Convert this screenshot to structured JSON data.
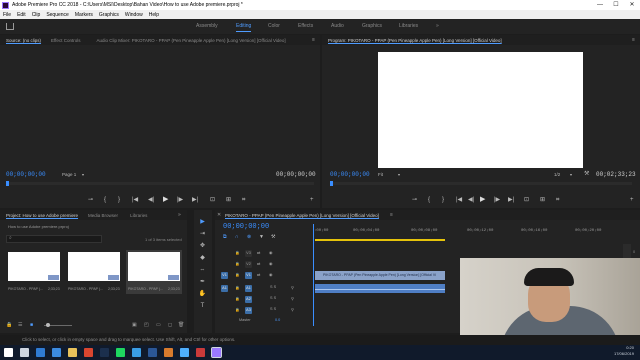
{
  "window": {
    "title": "Adobe Premiere Pro CC 2018 - C:\\Users\\MSI\\Desktop\\Bahan Video\\How to use Adobe premiere.prproj *",
    "minimize": "—",
    "maximize": "☐",
    "close": "✕"
  },
  "menu": [
    "File",
    "Edit",
    "Clip",
    "Sequence",
    "Markers",
    "Graphics",
    "Window",
    "Help"
  ],
  "workspaces": {
    "items": [
      "Assembly",
      "Editing",
      "Color",
      "Effects",
      "Audio",
      "Graphics",
      "Libraries"
    ],
    "active": "Editing",
    "more": "»"
  },
  "source": {
    "tabs": [
      "Source: (no clips)",
      "Effect Controls",
      "Audio Clip Mixer: PIKOTARO - PPAP (Pen Pineapple Apple Pen) [Long Version] [Official Video]"
    ],
    "tab_menu": "≡",
    "timecode_left": "00;00;00;00",
    "page_label": "Page 1",
    "timecode_right": "00;00;00;00"
  },
  "program": {
    "tab": "Program: PIKOTARO - PPAP (Pen Pineapple Apple Pen) [Long Version] [Official Video]",
    "tab_menu": "≡",
    "timecode_left": "00;00;00;00",
    "fit": "Fit",
    "resolution": "1/2",
    "timecode_right": "00;02;33;23"
  },
  "transport": [
    "⊸",
    "{",
    "}",
    "|◀",
    "◀|",
    "▶",
    "|▶",
    "▶|",
    "⊡",
    "⊞",
    "⌗",
    "+"
  ],
  "project": {
    "tabs": [
      "Project: How to use Adobe premiere",
      "Media Browser",
      "Libraries"
    ],
    "more": "»",
    "file_name": "How to use Adobe premiere.prproj",
    "selection": "1 of 3 items selected",
    "items": [
      {
        "label": "PIKOTARO - PPAP (...",
        "duration": "2;33;23"
      },
      {
        "label": "PIKOTARO - PPAP (...",
        "duration": "2;33;23"
      },
      {
        "label": "PIKOTARO - PPAP (...",
        "duration": "2;33;23"
      }
    ]
  },
  "tools": [
    "arrow-tool",
    "track-select-tool",
    "ripple-edit-tool",
    "razor-tool",
    "slip-tool",
    "pen-tool",
    "hand-tool",
    "type-tool"
  ],
  "tool_glyphs": [
    "▶",
    "⇥",
    "✥",
    "◆",
    "⇔",
    "✒",
    "✋",
    "T"
  ],
  "timeline": {
    "tab": "PIKOTARO - PPAP (Pen Pineapple Apple Pen) [Long Version] [Official Video]",
    "tab_menu": "≡",
    "timecode": "00;00;00;00",
    "ruler": [
      ":00;00",
      "00;00;04;00",
      "00;00;08;00",
      "00;00;12;00",
      "00;00;16;00",
      "00;00;20;00"
    ],
    "tracks": [
      {
        "label": "V3",
        "type": "video"
      },
      {
        "label": "V2",
        "type": "video"
      },
      {
        "label": "V1",
        "type": "video"
      },
      {
        "label": "A1",
        "type": "audio"
      },
      {
        "label": "A2",
        "type": "audio"
      },
      {
        "label": "A3",
        "type": "audio"
      }
    ],
    "target_v": "V1",
    "target_a": "A1",
    "clip_title": "PIKOTARO - PPAP (Pen Pineapple Apple Pen) [Long Version] [Official Vi",
    "master": "Master",
    "master_value": "0.0",
    "audio_meters": "S S"
  },
  "status": "Click to select, or click in empty space and drag to marquee select. Use Shift, Alt, and Ctrl for other options.",
  "taskbar": {
    "clock": "0:20",
    "date": "17/06/2019",
    "icons": [
      {
        "name": "windows-icon",
        "color": "#ffffff"
      },
      {
        "name": "task-view-icon",
        "color": "#cfd6df"
      },
      {
        "name": "edge-icon",
        "color": "#2f7bd3"
      },
      {
        "name": "store-icon",
        "color": "#3c8be0"
      },
      {
        "name": "explorer-icon",
        "color": "#e8c15a"
      },
      {
        "name": "chrome-icon",
        "color": "#d9462f"
      },
      {
        "name": "steam-icon",
        "color": "#1b2f4d"
      },
      {
        "name": "spotify-icon",
        "color": "#1ed760"
      },
      {
        "name": "app-icon",
        "color": "#3a9ee6"
      },
      {
        "name": "word-icon",
        "color": "#2b5797"
      },
      {
        "name": "lightroom-icon",
        "color": "#d87b2d"
      },
      {
        "name": "app2-icon",
        "color": "#4fb0ff"
      },
      {
        "name": "media-icon",
        "color": "#c93a3a"
      },
      {
        "name": "premiere-icon",
        "color": "#9a79ff"
      }
    ]
  },
  "colors": {
    "accent": "#4f9cff",
    "timecode": "#3a8eff",
    "clip_video": "#8aa2c9",
    "clip_audio": "#4f7ec4",
    "work_area": "#e5c30b"
  }
}
